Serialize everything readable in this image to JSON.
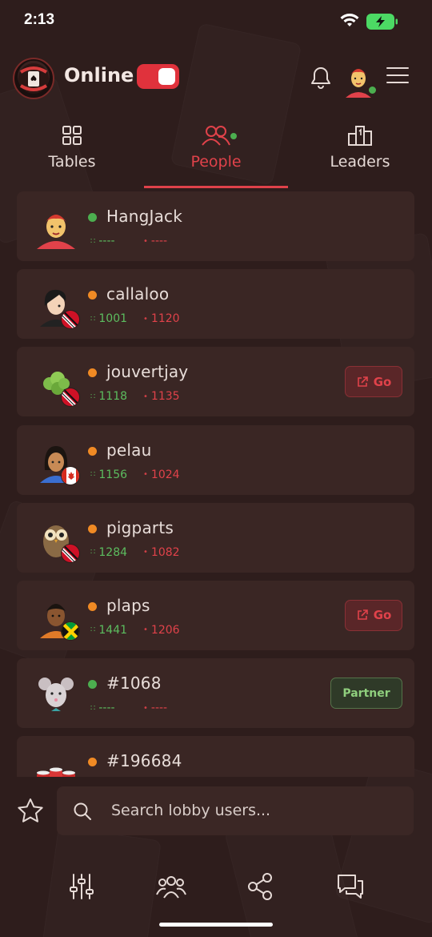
{
  "status_bar": {
    "time": "2:13"
  },
  "header": {
    "online_label": "Online",
    "online_toggle": true,
    "icons": [
      "logo-icon",
      "bell-icon",
      "avatar",
      "menu-icon"
    ]
  },
  "tabs": [
    {
      "label": "Tables",
      "icon": "grid-icon",
      "active": false
    },
    {
      "label": "People",
      "icon": "people-icon",
      "active": true
    },
    {
      "label": "Leaders",
      "icon": "podium-icon",
      "active": false
    }
  ],
  "users": [
    {
      "name": "HangJack",
      "status": "online",
      "stat_a": "----",
      "stat_b": "----",
      "flag": "none",
      "action": ""
    },
    {
      "name": "callaloo",
      "status": "away",
      "stat_a": "1001",
      "stat_b": "1120",
      "flag": "trinidad",
      "action": ""
    },
    {
      "name": "jouvertjay",
      "status": "away",
      "stat_a": "1118",
      "stat_b": "1135",
      "flag": "trinidad",
      "action": "Go"
    },
    {
      "name": "pelau",
      "status": "away",
      "stat_a": "1156",
      "stat_b": "1024",
      "flag": "canada",
      "action": ""
    },
    {
      "name": "pigparts",
      "status": "away",
      "stat_a": "1284",
      "stat_b": "1082",
      "flag": "trinidad",
      "action": ""
    },
    {
      "name": "plaps",
      "status": "away",
      "stat_a": "1441",
      "stat_b": "1206",
      "flag": "jamaica",
      "action": "Go"
    },
    {
      "name": "#1068",
      "status": "online",
      "stat_a": "----",
      "stat_b": "----",
      "flag": "none",
      "action": "Partner"
    },
    {
      "name": "#196684",
      "status": "away",
      "stat_a": "",
      "stat_b": "",
      "flag": "none",
      "action": ""
    }
  ],
  "search": {
    "placeholder": "Search lobby users..."
  },
  "bottom_nav": [
    "sliders-icon",
    "group-icon",
    "share-icon",
    "chat-icon"
  ],
  "colors": {
    "background": "#2e1d1c",
    "card": "#3a2624",
    "accent_red": "#e0424a",
    "online_green": "#4cae4f",
    "away_orange": "#f08a24",
    "partner_green": "#8fcf7d"
  }
}
